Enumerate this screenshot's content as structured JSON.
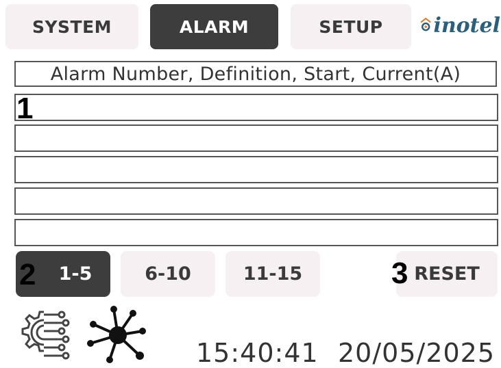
{
  "tabs": [
    {
      "label": "SYSTEM",
      "active": false
    },
    {
      "label": "ALARM",
      "active": true
    },
    {
      "label": "SETUP",
      "active": false
    }
  ],
  "logo": {
    "text": "inotel"
  },
  "alarm_table": {
    "header": "Alarm Number, Definition, Start, Current(A)",
    "rows": [
      "",
      "",
      "",
      "",
      ""
    ]
  },
  "pagination": {
    "pages": [
      "1-5",
      "6-10",
      "11-15"
    ],
    "active_page": "1-5"
  },
  "reset_label": "RESET",
  "callouts": [
    "1",
    "2",
    "3"
  ],
  "status": {
    "time": "15:40:41",
    "date": "20/05/2025"
  },
  "icons": {
    "settings": "settings-circuit-icon",
    "network": "network-hub-icon"
  },
  "colors": {
    "active_bg": "#3d3d3d",
    "inactive_bg": "#f7f0f2",
    "logo": "#2c5f7c",
    "logo_accent": "#e07b2a"
  }
}
